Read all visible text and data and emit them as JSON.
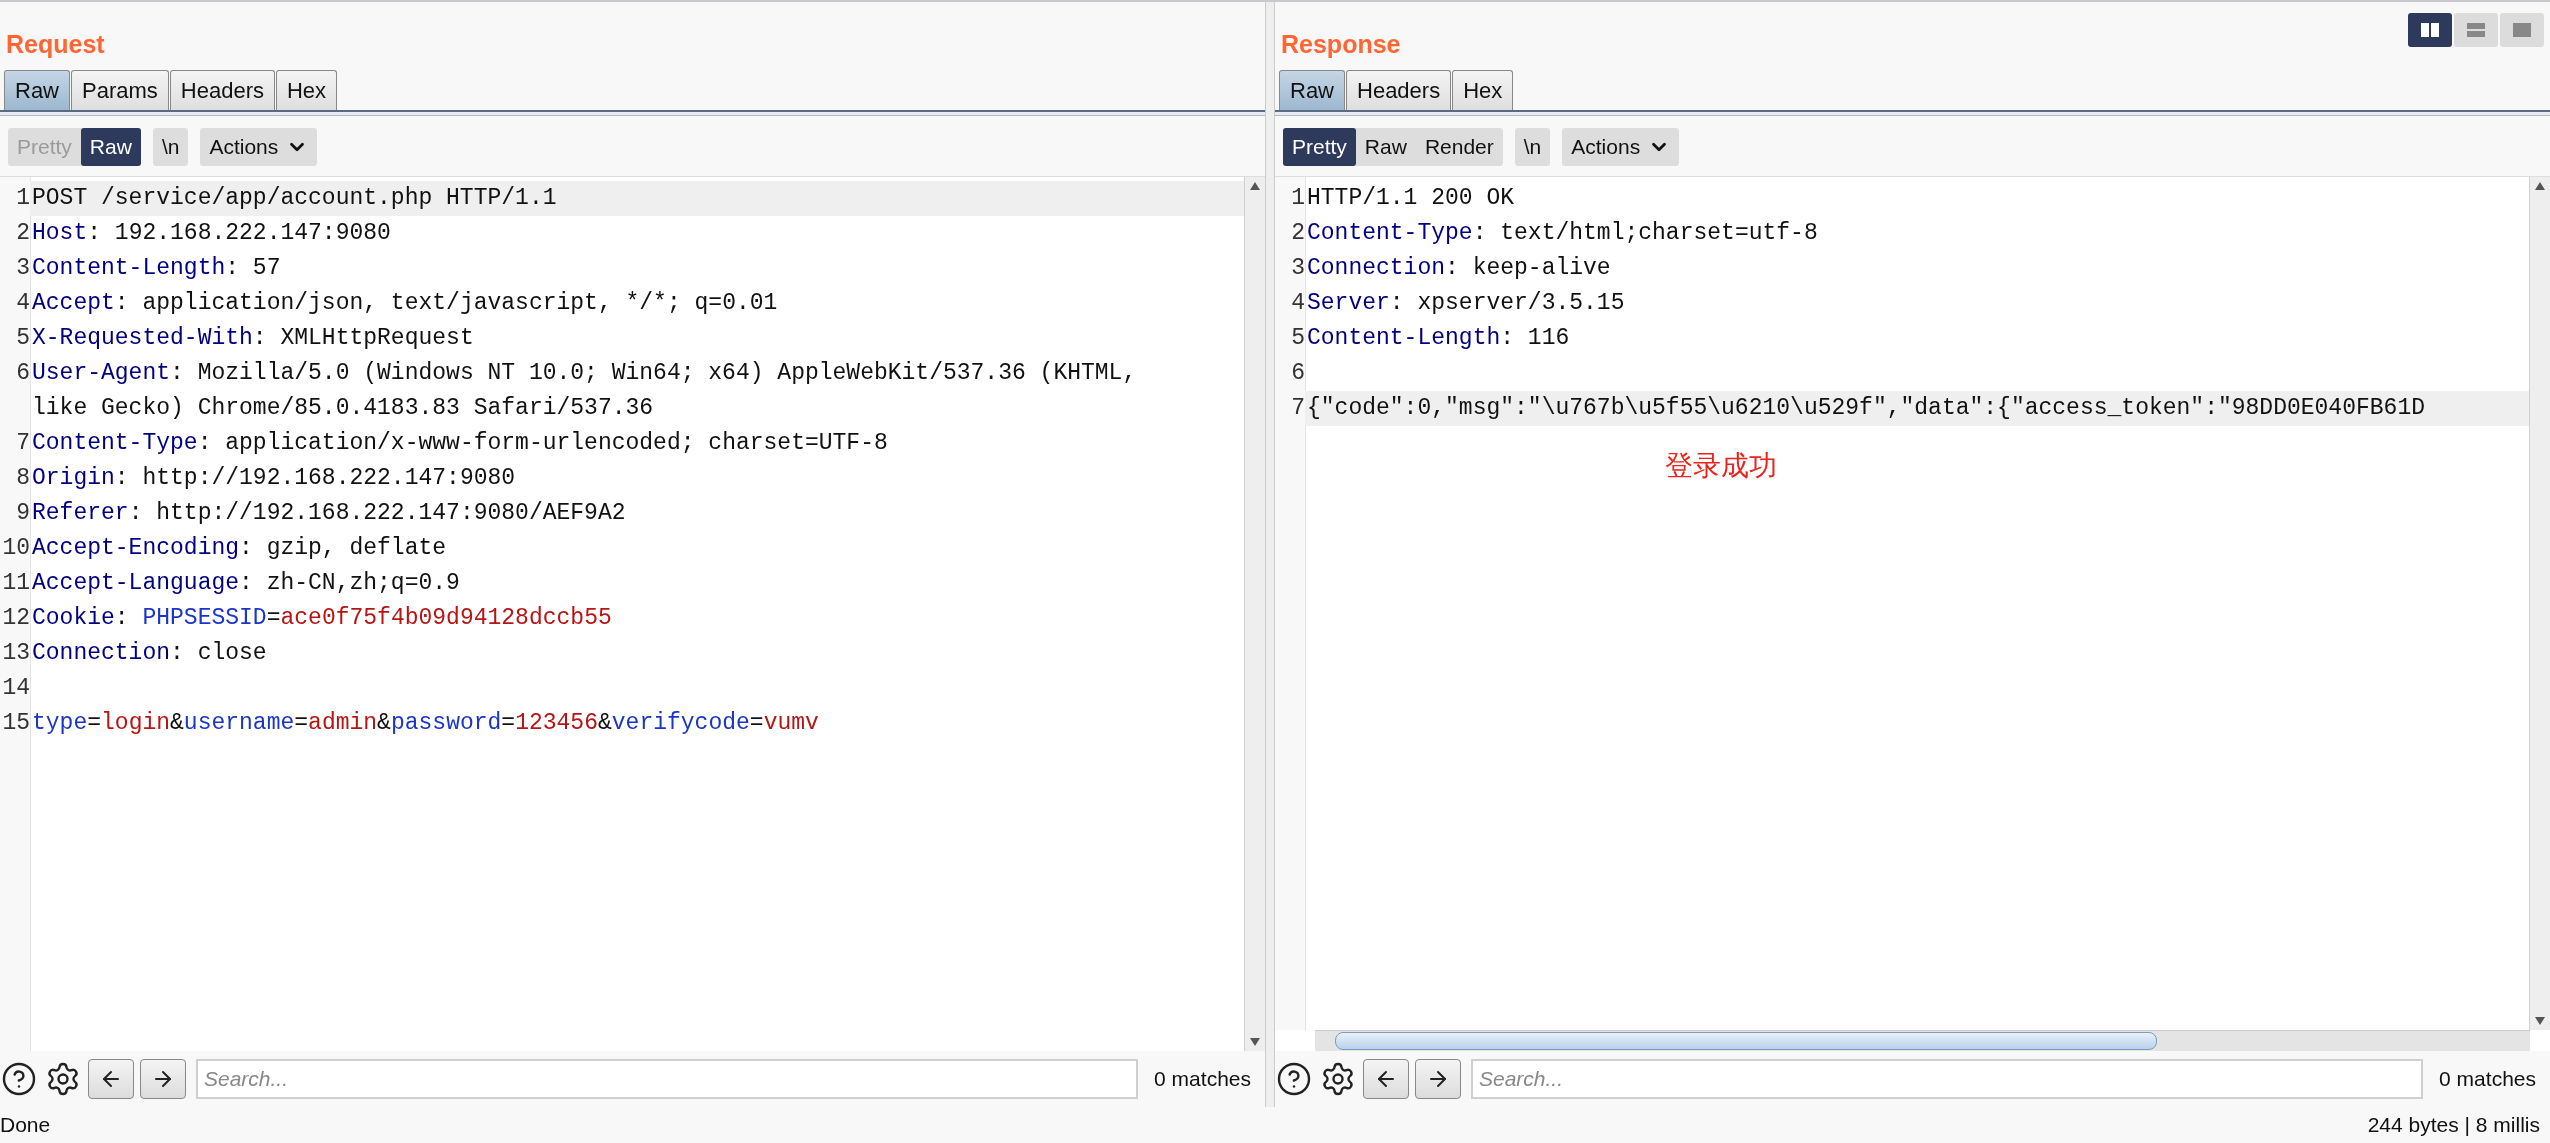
{
  "layout_buttons": [
    {
      "kind": "columns",
      "selected": true
    },
    {
      "kind": "rows",
      "selected": false
    },
    {
      "kind": "single",
      "selected": false
    }
  ],
  "request": {
    "title": "Request",
    "tabs": [
      {
        "label": "Raw",
        "selected": true
      },
      {
        "label": "Params",
        "selected": false
      },
      {
        "label": "Headers",
        "selected": false
      },
      {
        "label": "Hex",
        "selected": false
      }
    ],
    "toolbar": {
      "modes": [
        {
          "label": "Pretty",
          "selected": false,
          "disabled": true
        },
        {
          "label": "Raw",
          "selected": true,
          "disabled": false
        }
      ],
      "newline": {
        "label": "\\n",
        "selected": false
      },
      "actions": "Actions"
    },
    "lines": [
      {
        "number": "1",
        "highlighted": true,
        "segments": [
          {
            "kind": "plain",
            "text": "POST /service/app/account.php HTTP/1.1"
          }
        ]
      },
      {
        "number": "2",
        "highlighted": false,
        "segments": [
          {
            "kind": "key",
            "text": "Host"
          },
          {
            "kind": "plain",
            "text": ": 192.168.222.147:9080"
          }
        ]
      },
      {
        "number": "3",
        "highlighted": false,
        "segments": [
          {
            "kind": "key",
            "text": "Content-Length"
          },
          {
            "kind": "plain",
            "text": ": 57"
          }
        ]
      },
      {
        "number": "4",
        "highlighted": false,
        "segments": [
          {
            "kind": "key",
            "text": "Accept"
          },
          {
            "kind": "plain",
            "text": ": application/json, text/javascript, */*; q=0.01"
          }
        ]
      },
      {
        "number": "5",
        "highlighted": false,
        "segments": [
          {
            "kind": "key",
            "text": "X-Requested-With"
          },
          {
            "kind": "plain",
            "text": ": XMLHttpRequest"
          }
        ]
      },
      {
        "number": "6",
        "highlighted": false,
        "segments": [
          {
            "kind": "key",
            "text": "User-Agent"
          },
          {
            "kind": "plain",
            "text": ": Mozilla/5.0 (Windows NT 10.0; Win64; x64) AppleWebKit/537.36 (KHTML, like Gecko) Chrome/85.0.4183.83 Safari/537.36"
          }
        ]
      },
      {
        "number": "7",
        "highlighted": false,
        "segments": [
          {
            "kind": "key",
            "text": "Content-Type"
          },
          {
            "kind": "plain",
            "text": ": application/x-www-form-urlencoded; charset=UTF-8"
          }
        ]
      },
      {
        "number": "8",
        "highlighted": false,
        "segments": [
          {
            "kind": "key",
            "text": "Origin"
          },
          {
            "kind": "plain",
            "text": ": http://192.168.222.147:9080"
          }
        ]
      },
      {
        "number": "9",
        "highlighted": false,
        "segments": [
          {
            "kind": "key",
            "text": "Referer"
          },
          {
            "kind": "plain",
            "text": ": http://192.168.222.147:9080/AEF9A2"
          }
        ]
      },
      {
        "number": "10",
        "highlighted": false,
        "segments": [
          {
            "kind": "key",
            "text": "Accept-Encoding"
          },
          {
            "kind": "plain",
            "text": ": gzip, deflate"
          }
        ]
      },
      {
        "number": "11",
        "highlighted": false,
        "segments": [
          {
            "kind": "key",
            "text": "Accept-Language"
          },
          {
            "kind": "plain",
            "text": ": zh-CN,zh;q=0.9"
          }
        ]
      },
      {
        "number": "12",
        "highlighted": false,
        "segments": [
          {
            "kind": "key",
            "text": "Cookie"
          },
          {
            "kind": "plain",
            "text": ": "
          },
          {
            "kind": "param",
            "text": "PHPSESSID"
          },
          {
            "kind": "plain",
            "text": "="
          },
          {
            "kind": "value",
            "text": "ace0f75f4b09d94128dccb55"
          }
        ]
      },
      {
        "number": "13",
        "highlighted": false,
        "segments": [
          {
            "kind": "key",
            "text": "Connection"
          },
          {
            "kind": "plain",
            "text": ": close"
          }
        ]
      },
      {
        "number": "14",
        "highlighted": false
      },
      {
        "number": "15",
        "highlighted": false,
        "segments": [
          {
            "kind": "param",
            "text": "type"
          },
          {
            "kind": "plain",
            "text": "="
          },
          {
            "kind": "value",
            "text": "login"
          },
          {
            "kind": "plain",
            "text": "&"
          },
          {
            "kind": "param",
            "text": "username"
          },
          {
            "kind": "plain",
            "text": "="
          },
          {
            "kind": "value",
            "text": "admin"
          },
          {
            "kind": "plain",
            "text": "&"
          },
          {
            "kind": "param",
            "text": "password"
          },
          {
            "kind": "plain",
            "text": "="
          },
          {
            "kind": "value",
            "text": "123456"
          },
          {
            "kind": "plain",
            "text": "&"
          },
          {
            "kind": "param",
            "text": "verifycode"
          },
          {
            "kind": "plain",
            "text": "="
          },
          {
            "kind": "value",
            "text": "vumv"
          }
        ]
      }
    ],
    "search": {
      "placeholder": "Search...",
      "matches": "0 matches"
    }
  },
  "response": {
    "title": "Response",
    "tabs": [
      {
        "label": "Raw",
        "selected": true
      },
      {
        "label": "Headers",
        "selected": false
      },
      {
        "label": "Hex",
        "selected": false
      }
    ],
    "toolbar": {
      "modes": [
        {
          "label": "Pretty",
          "selected": true,
          "disabled": false
        },
        {
          "label": "Raw",
          "selected": false,
          "disabled": false
        },
        {
          "label": "Render",
          "selected": false,
          "disabled": false
        }
      ],
      "newline": {
        "label": "\\n",
        "selected": false
      },
      "actions": "Actions"
    },
    "lines": [
      {
        "number": "1",
        "highlighted": false,
        "segments": [
          {
            "kind": "plain",
            "text": "HTTP/1.1 200 OK"
          }
        ]
      },
      {
        "number": "2",
        "highlighted": false,
        "segments": [
          {
            "kind": "key",
            "text": "Content-Type"
          },
          {
            "kind": "plain",
            "text": ": text/html;charset=utf-8"
          }
        ]
      },
      {
        "number": "3",
        "highlighted": false,
        "segments": [
          {
            "kind": "key",
            "text": "Connection"
          },
          {
            "kind": "plain",
            "text": ": keep-alive"
          }
        ]
      },
      {
        "number": "4",
        "highlighted": false,
        "segments": [
          {
            "kind": "key",
            "text": "Server"
          },
          {
            "kind": "plain",
            "text": ": xpserver/3.5.15"
          }
        ]
      },
      {
        "number": "5",
        "highlighted": false,
        "segments": [
          {
            "kind": "key",
            "text": "Content-Length"
          },
          {
            "kind": "plain",
            "text": ": 116"
          }
        ]
      },
      {
        "number": "6",
        "highlighted": false
      },
      {
        "number": "7",
        "highlighted": true,
        "segments": [
          {
            "kind": "plain",
            "text": "{\"code\":0,\"msg\":\"\\u767b\\u5f55\\u6210\\u529f\",\"data\":{\"access_token\":\"98DD0E040FB61D"
          }
        ]
      }
    ],
    "annotation": "登录成功",
    "search": {
      "placeholder": "Search...",
      "matches": "0 matches"
    }
  },
  "status_bar": {
    "left": "Done",
    "right": "244 bytes | 8 millis"
  }
}
